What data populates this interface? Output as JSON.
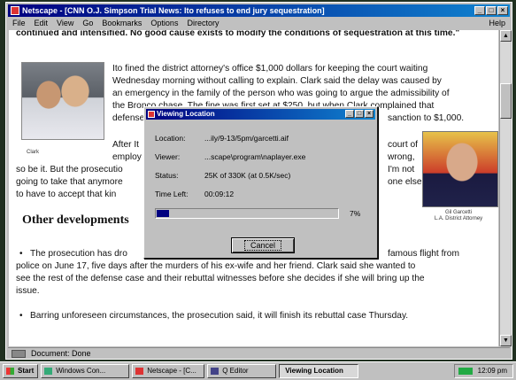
{
  "browser": {
    "title": "Netscape - [CNN O.J. Simpson Trial News: Ito refuses to end jury sequestration]",
    "menu": [
      "File",
      "Edit",
      "View",
      "Go",
      "Bookmarks",
      "Options",
      "Directory"
    ],
    "help": "Help",
    "status": "Document: Done"
  },
  "article": {
    "lines": [
      "continued and intensified. No good cause exists to modify the conditions of sequestration at this time.\"",
      "Ito fined the district attorney's office $1,000 dollars for keeping the court waiting",
      "Wednesday morning without calling to explain. Clark said the delay was caused by",
      "an emergency in the family of the person who was going to argue the admissibility of",
      "the Bronco chase. The fine was first set at $250, but when Clark complained that",
      "defense",
      "sanction to $1,000.",
      "After It",
      "court of",
      "employ",
      "wrong,",
      "so be it. But the prosecutio",
      "I'm not",
      "going to take that anymore",
      "one else",
      "to have to accept that kin"
    ],
    "heading": "Other developments",
    "bullets": [
      [
        "The prosecution has dro",
        "famous flight from"
      ],
      [
        "police on June 17, five days after the murders of his ex-wife and her friend. Clark said she wanted to"
      ],
      [
        "see the rest of the defense case and their rebuttal witnesses before she decides if she will bring up the"
      ],
      [
        "issue."
      ],
      [
        "Barring unforeseen circumstances, the prosecution said, it will finish its rebuttal case Thursday."
      ]
    ],
    "photo1_caption": "Clark",
    "photo2_caption_1": "Gil Garcetti",
    "photo2_caption_2": "L.A. District Attorney"
  },
  "dialog": {
    "title": "Viewing Location",
    "location_label": "Location:",
    "location_value": "...ily/9-13/5pm/garcetti.aif",
    "viewer_label": "Viewer:",
    "viewer_value": "...scape\\program\\naplayer.exe",
    "status_label": "Status:",
    "status_value": "25K of 330K (at 0.5K/sec)",
    "timeleft_label": "Time Left:",
    "timeleft_value": "00:09:12",
    "progress": 0.07,
    "percent": "7%",
    "cancel": "Cancel"
  },
  "taskbar": {
    "start": "Start",
    "items": [
      "Windows Con...",
      "Netscape - [C...",
      "Q Editor",
      "Viewing Location"
    ],
    "clock": "12:09 pm"
  }
}
